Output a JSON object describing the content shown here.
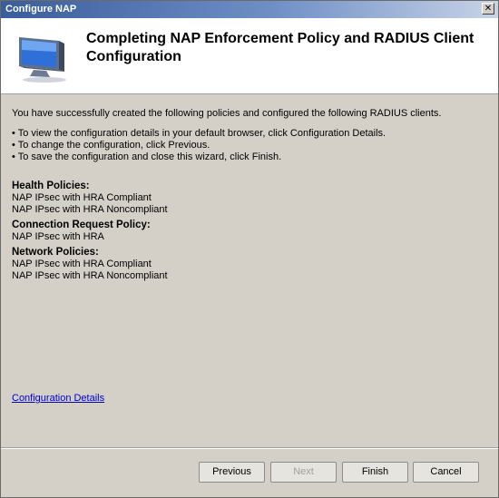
{
  "window": {
    "title": "Configure NAP",
    "close_glyph": "✕"
  },
  "header": {
    "title": "Completing NAP Enforcement Policy and RADIUS Client Configuration",
    "icon": "monitor-icon"
  },
  "content": {
    "intro": "You have successfully created the following policies and configured the following RADIUS clients.",
    "bullets": [
      "• To view the configuration details in your default browser, click Configuration Details.",
      "• To change the configuration, click Previous.",
      "• To save the configuration and close this wizard, click Finish."
    ],
    "sections": [
      {
        "heading": "Health Policies:",
        "items": [
          "NAP IPsec with HRA Compliant",
          "NAP IPsec with HRA Noncompliant"
        ]
      },
      {
        "heading": "Connection Request Policy:",
        "items": [
          "NAP IPsec with HRA"
        ]
      },
      {
        "heading": "Network Policies:",
        "items": [
          "NAP IPsec with HRA Compliant",
          "NAP IPsec with HRA Noncompliant"
        ]
      }
    ],
    "link": "Configuration Details"
  },
  "buttons": {
    "previous": "Previous",
    "next": "Next",
    "finish": "Finish",
    "cancel": "Cancel"
  }
}
